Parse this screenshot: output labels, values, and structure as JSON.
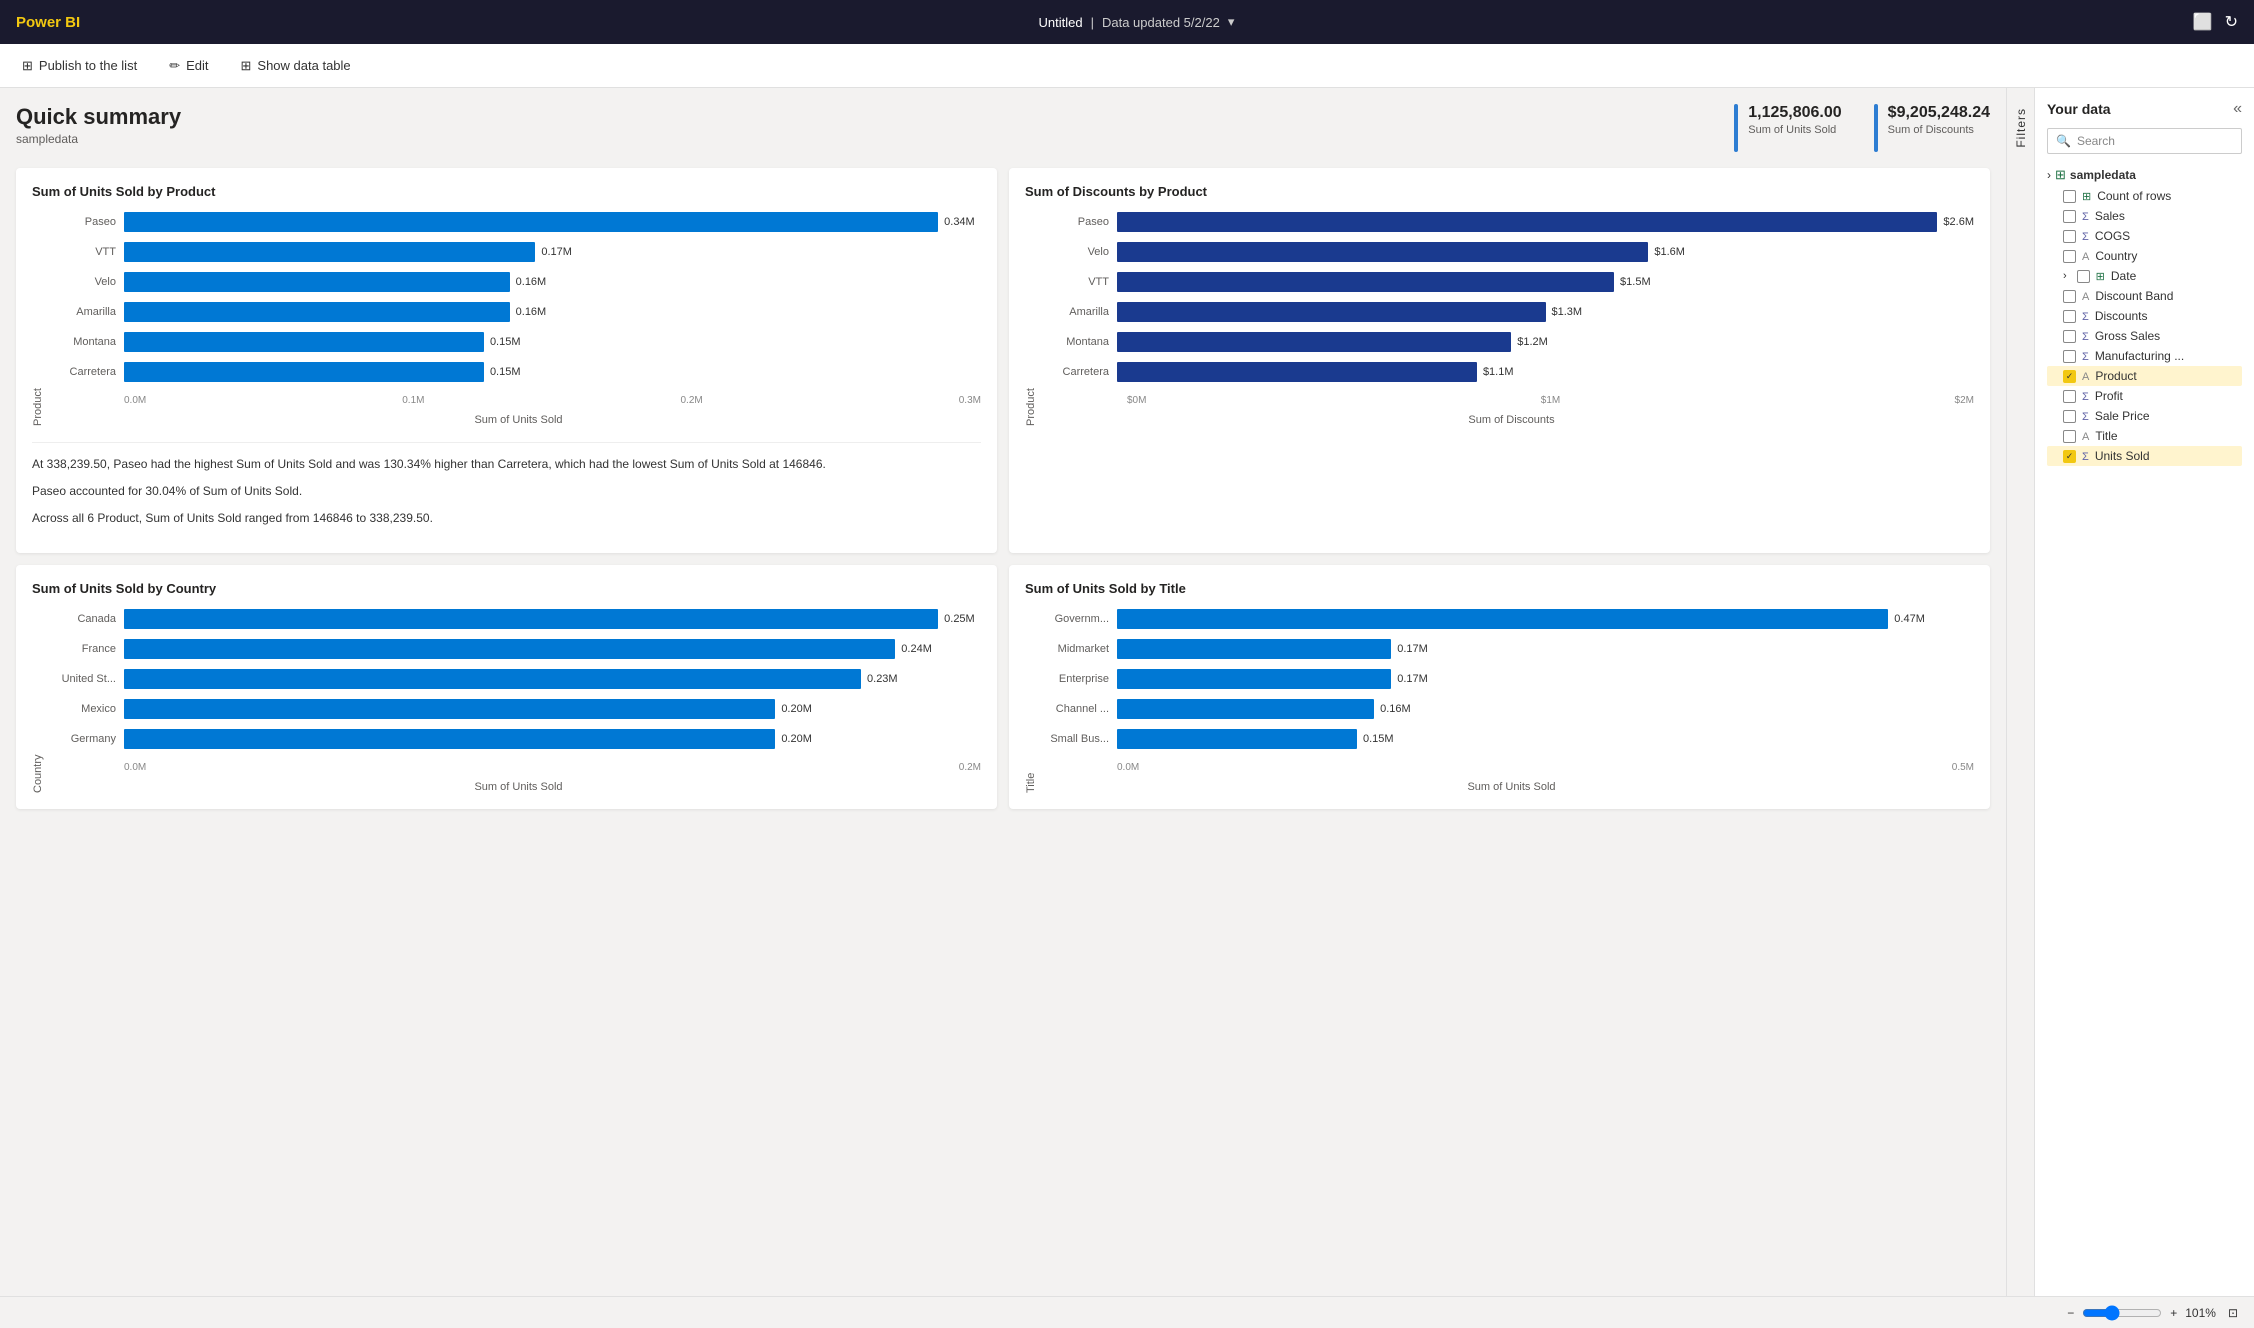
{
  "topbar": {
    "logo": "Power BI",
    "title": "Untitled",
    "data_info": "Data updated 5/2/22",
    "chevron": "▾",
    "window_icon": "⬜",
    "refresh_icon": "↻"
  },
  "toolbar": {
    "publish_icon": "⊞",
    "publish_label": "Publish to the list",
    "edit_icon": "✏",
    "edit_label": "Edit",
    "table_icon": "⊞",
    "table_label": "Show data table"
  },
  "summary": {
    "title": "Quick summary",
    "subtitle": "sampledata",
    "kpis": [
      {
        "value": "1,125,806.00",
        "label": "Sum of Units Sold"
      },
      {
        "value": "$9,205,248.24",
        "label": "Sum of Discounts"
      }
    ]
  },
  "chart_units_by_product": {
    "title": "Sum of Units Sold by Product",
    "x_axis_label": "Sum of Units Sold",
    "x_ticks": [
      "0.0M",
      "0.1M",
      "0.2M",
      "0.3M"
    ],
    "y_axis_label": "Product",
    "bars": [
      {
        "label": "Paseo",
        "value": "0.34M",
        "width_pct": 95
      },
      {
        "label": "VTT",
        "value": "0.17M",
        "width_pct": 48
      },
      {
        "label": "Velo",
        "value": "0.16M",
        "width_pct": 45
      },
      {
        "label": "Amarilla",
        "value": "0.16M",
        "width_pct": 45
      },
      {
        "label": "Montana",
        "value": "0.15M",
        "width_pct": 42
      },
      {
        "label": "Carretera",
        "value": "0.15M",
        "width_pct": 42
      }
    ],
    "description": [
      "At 338,239.50, Paseo had the highest Sum of Units Sold and was 130.34% higher than Carretera, which had the lowest Sum of Units Sold at 146846.",
      "Paseo accounted for 30.04% of Sum of Units Sold.",
      "Across all 6 Product, Sum of Units Sold ranged from 146846 to 338,239.50."
    ]
  },
  "chart_discounts_by_product": {
    "title": "Sum of Discounts by Product",
    "x_axis_label": "Sum of Discounts",
    "x_ticks": [
      "$0M",
      "$1M",
      "$2M"
    ],
    "y_axis_label": "Product",
    "bars": [
      {
        "label": "Paseo",
        "value": "$2.6M",
        "width_pct": 100
      },
      {
        "label": "Velo",
        "value": "$1.6M",
        "width_pct": 62
      },
      {
        "label": "VTT",
        "value": "$1.5M",
        "width_pct": 58
      },
      {
        "label": "Amarilla",
        "value": "$1.3M",
        "width_pct": 50
      },
      {
        "label": "Montana",
        "value": "$1.2M",
        "width_pct": 46
      },
      {
        "label": "Carretera",
        "value": "$1.1M",
        "width_pct": 42
      }
    ]
  },
  "chart_units_by_country": {
    "title": "Sum of Units Sold by Country",
    "x_axis_label": "Sum of Units Sold",
    "x_ticks": [
      "0.0M",
      "0.2M"
    ],
    "y_axis_label": "Country",
    "bars": [
      {
        "label": "Canada",
        "value": "0.25M",
        "width_pct": 95
      },
      {
        "label": "France",
        "value": "0.24M",
        "width_pct": 90
      },
      {
        "label": "United St...",
        "value": "0.23M",
        "width_pct": 86
      },
      {
        "label": "Mexico",
        "value": "0.20M",
        "width_pct": 76
      },
      {
        "label": "Germany",
        "value": "0.20M",
        "width_pct": 76
      }
    ]
  },
  "chart_units_by_title": {
    "title": "Sum of Units Sold by Title",
    "x_axis_label": "Sum of Units Sold",
    "x_ticks": [
      "0.0M",
      "0.5M"
    ],
    "y_axis_label": "Title",
    "bars": [
      {
        "label": "Governm...",
        "value": "0.47M",
        "width_pct": 90
      },
      {
        "label": "Midmarket",
        "value": "0.17M",
        "width_pct": 32
      },
      {
        "label": "Enterprise",
        "value": "0.17M",
        "width_pct": 32
      },
      {
        "label": "Channel ...",
        "value": "0.16M",
        "width_pct": 30
      },
      {
        "label": "Small Bus...",
        "value": "0.15M",
        "width_pct": 28
      }
    ]
  },
  "sidebar": {
    "title": "Your data",
    "search_placeholder": "Search",
    "filters_label": "Filters",
    "collapse_icon": "«",
    "group": {
      "name": "sampledata",
      "chevron": "›",
      "items": [
        {
          "label": "Count of rows",
          "type": "count",
          "checked": false
        },
        {
          "label": "Sales",
          "type": "sigma",
          "checked": false
        },
        {
          "label": "COGS",
          "type": "sigma",
          "checked": false
        },
        {
          "label": "Country",
          "type": "text",
          "checked": false
        },
        {
          "label": "Date",
          "type": "table",
          "checked": false,
          "expandable": true
        },
        {
          "label": "Discount Band",
          "type": "text",
          "checked": false
        },
        {
          "label": "Discounts",
          "type": "sigma",
          "checked": false
        },
        {
          "label": "Gross Sales",
          "type": "sigma",
          "checked": false
        },
        {
          "label": "Manufacturing ...",
          "type": "sigma",
          "checked": false
        },
        {
          "label": "Product",
          "type": "text",
          "checked": true,
          "highlighted": true
        },
        {
          "label": "Profit",
          "type": "sigma",
          "checked": false
        },
        {
          "label": "Sale Price",
          "type": "sigma",
          "checked": false
        },
        {
          "label": "Title",
          "type": "text",
          "checked": false
        },
        {
          "label": "Units Sold",
          "type": "sigma",
          "checked": true,
          "highlighted": true
        }
      ]
    }
  },
  "bottom_bar": {
    "zoom": "101%",
    "plus": "+",
    "minus": "−"
  }
}
